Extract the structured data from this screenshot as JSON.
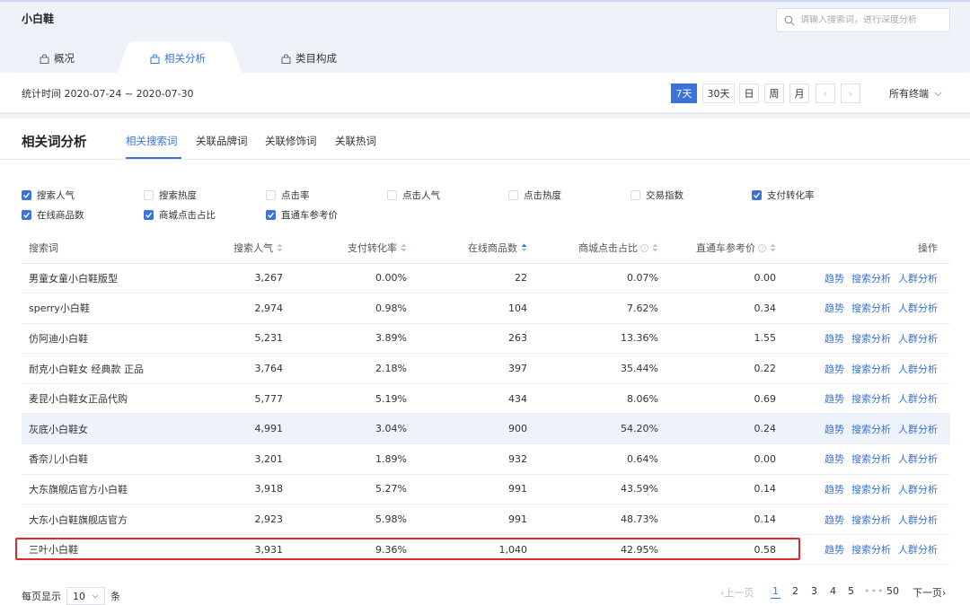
{
  "app": {
    "title": "小白鞋"
  },
  "search": {
    "placeholder": "请输入搜索词，进行深度分析"
  },
  "main_tabs": [
    {
      "label": "概况"
    },
    {
      "label": "相关分析",
      "active": true
    },
    {
      "label": "类目构成"
    }
  ],
  "date_range": {
    "label": "统计时间 2020-07-24 ~ 2020-07-30"
  },
  "period_buttons": [
    "7天",
    "30天",
    "日",
    "周",
    "月"
  ],
  "period_active": "7天",
  "nav": {
    "prev": "‹",
    "next": "›"
  },
  "terminal": {
    "label": "所有终端"
  },
  "analysis": {
    "title": "相关词分析",
    "sub_tabs": [
      "相关搜索词",
      "关联品牌词",
      "关联修饰词",
      "关联热词"
    ],
    "active_sub_tab": "相关搜索词"
  },
  "filters": [
    {
      "label": "搜索人气",
      "checked": true
    },
    {
      "label": "搜索热度",
      "checked": false
    },
    {
      "label": "点击率",
      "checked": false
    },
    {
      "label": "点击人气",
      "checked": false
    },
    {
      "label": "点击热度",
      "checked": false
    },
    {
      "label": "交易指数",
      "checked": false
    },
    {
      "label": "支付转化率",
      "checked": true
    },
    {
      "label": "在线商品数",
      "checked": true
    },
    {
      "label": "商城点击占比",
      "checked": true
    },
    {
      "label": "直通车参考价",
      "checked": true
    }
  ],
  "table": {
    "headers": {
      "keyword": "搜索词",
      "popularity": "搜索人气",
      "conversion": "支付转化率",
      "products": "在线商品数",
      "mall_click": "商城点击占比",
      "ztc_price": "直通车参考价",
      "actions": "操作"
    },
    "action_labels": {
      "trend": "趋势",
      "search": "搜索分析",
      "crowd": "人群分析"
    },
    "rows": [
      {
        "keyword": "男童女童小白鞋版型",
        "popularity": "3,267",
        "conversion": "0.00%",
        "products": "22",
        "mall_click": "0.07%",
        "ztc_price": "0.00"
      },
      {
        "keyword": "sperry小白鞋",
        "popularity": "2,974",
        "conversion": "0.98%",
        "products": "104",
        "mall_click": "7.62%",
        "ztc_price": "0.34"
      },
      {
        "keyword": "仿阿迪小白鞋",
        "popularity": "5,231",
        "conversion": "3.89%",
        "products": "263",
        "mall_click": "13.36%",
        "ztc_price": "1.55"
      },
      {
        "keyword": "耐克小白鞋女 经典款 正品",
        "popularity": "3,764",
        "conversion": "2.18%",
        "products": "397",
        "mall_click": "35.44%",
        "ztc_price": "0.22"
      },
      {
        "keyword": "麦昆小白鞋女正品代购",
        "popularity": "5,777",
        "conversion": "5.19%",
        "products": "434",
        "mall_click": "8.06%",
        "ztc_price": "0.69"
      },
      {
        "keyword": "灰底小白鞋女",
        "popularity": "4,991",
        "conversion": "3.04%",
        "products": "900",
        "mall_click": "54.20%",
        "ztc_price": "0.24",
        "highlight": true
      },
      {
        "keyword": "香奈儿小白鞋",
        "popularity": "3,201",
        "conversion": "1.89%",
        "products": "932",
        "mall_click": "0.64%",
        "ztc_price": "0.00"
      },
      {
        "keyword": "大东旗舰店官方小白鞋",
        "popularity": "3,918",
        "conversion": "5.27%",
        "products": "991",
        "mall_click": "43.59%",
        "ztc_price": "0.14"
      },
      {
        "keyword": "大东小白鞋旗舰店官方",
        "popularity": "2,923",
        "conversion": "5.98%",
        "products": "991",
        "mall_click": "48.73%",
        "ztc_price": "0.14"
      },
      {
        "keyword": "三叶小白鞋",
        "popularity": "3,931",
        "conversion": "9.36%",
        "products": "1,040",
        "mall_click": "42.95%",
        "ztc_price": "0.58"
      }
    ]
  },
  "pagination": {
    "page_size_label": "每页显示",
    "page_size": "10",
    "page_size_unit": "条",
    "prev": "‹上一页",
    "pages": [
      "1",
      "2",
      "3",
      "4",
      "5"
    ],
    "ellipsis": "•••",
    "last": "50",
    "next": "下一页›",
    "current": "1"
  },
  "colors": {
    "accent": "#3a73d9",
    "highlight_frame": "#e02a2a",
    "top_bg": "#eef2f9"
  }
}
